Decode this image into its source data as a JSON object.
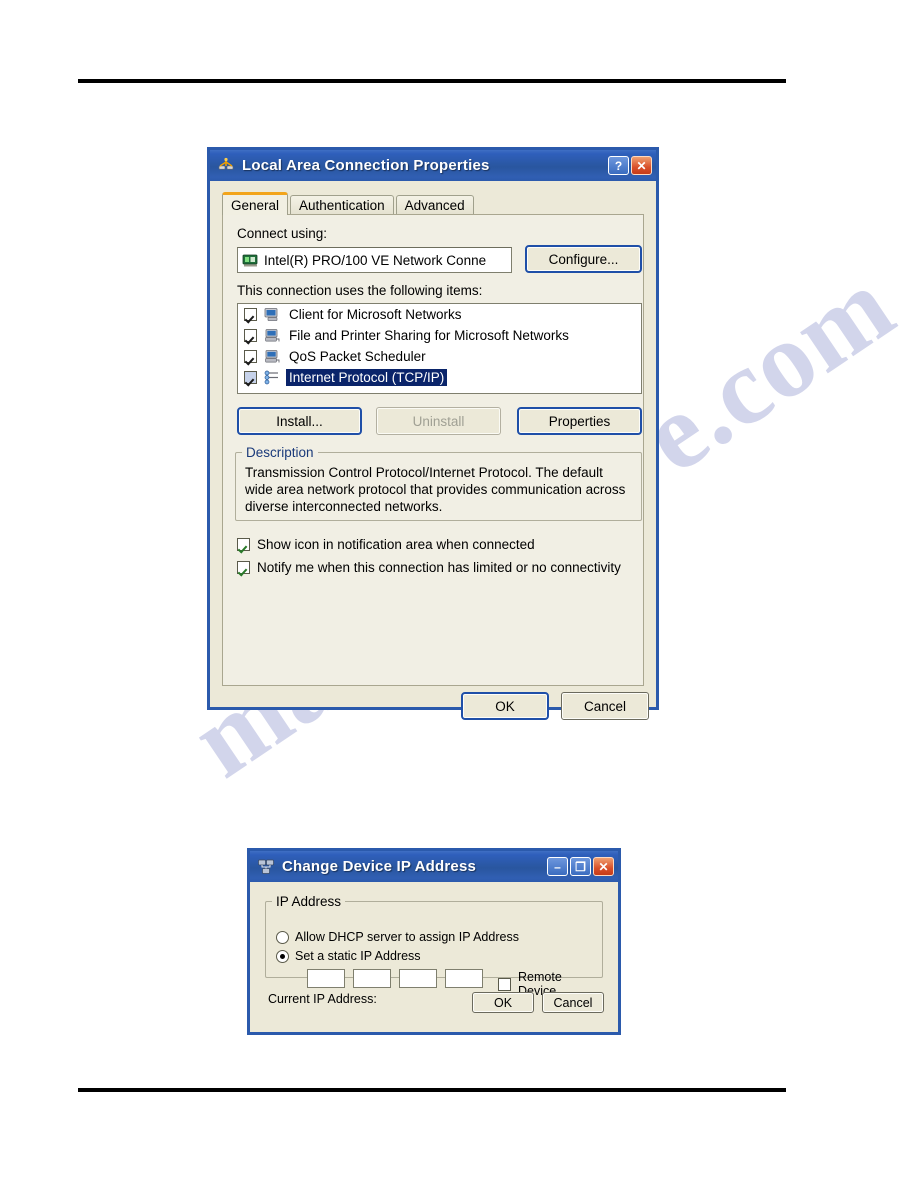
{
  "page": {
    "watermark": "manualshive.com"
  },
  "lan_dialog": {
    "title": "Local Area Connection Properties",
    "icon": "network-connection-icon",
    "titlebar_buttons": [
      {
        "name": "help-button",
        "glyph": "?"
      },
      {
        "name": "close-button",
        "glyph": "✕"
      }
    ],
    "tabs": [
      {
        "label": "General",
        "selected": true
      },
      {
        "label": "Authentication",
        "selected": false
      },
      {
        "label": "Advanced",
        "selected": false
      }
    ],
    "connect_using_label": "Connect using:",
    "adapter": {
      "name": "Intel(R) PRO/100 VE Network Conne",
      "icon": "network-adapter-icon"
    },
    "configure_button": "Configure...",
    "items_label": "This connection uses the following items:",
    "items": [
      {
        "label": "Client for Microsoft Networks",
        "checked": true,
        "selected": false,
        "icon": "client-computer-icon"
      },
      {
        "label": "File and Printer Sharing for Microsoft Networks",
        "checked": true,
        "selected": false,
        "icon": "file-sharing-icon"
      },
      {
        "label": "QoS Packet Scheduler",
        "checked": true,
        "selected": false,
        "icon": "qos-scheduler-icon"
      },
      {
        "label": "Internet Protocol (TCP/IP)",
        "checked": true,
        "selected": true,
        "icon": "protocol-icon"
      }
    ],
    "buttons": {
      "install": "Install...",
      "uninstall": "Uninstall",
      "properties": "Properties"
    },
    "description_legend": "Description",
    "description_text": "Transmission Control Protocol/Internet Protocol. The default wide area network protocol that provides communication across diverse interconnected networks.",
    "checkboxes": [
      {
        "label": "Show icon in notification area when connected",
        "checked": true
      },
      {
        "label": "Notify me when this connection has limited or no connectivity",
        "checked": true
      }
    ],
    "footer_buttons": {
      "ok": "OK",
      "cancel": "Cancel"
    }
  },
  "ip_dialog": {
    "title": "Change Device IP Address",
    "icon": "device-network-icon",
    "titlebar_buttons": [
      {
        "name": "minimize-button",
        "glyph": "–"
      },
      {
        "name": "maximize-button",
        "glyph": "❐"
      },
      {
        "name": "close-button",
        "glyph": "✕"
      }
    ],
    "group_legend": "IP Address",
    "radios": [
      {
        "label": "Allow DHCP server to assign IP Address",
        "selected": false
      },
      {
        "label": "Set a static IP Address",
        "selected": true
      }
    ],
    "octets": [
      "",
      "",
      "",
      ""
    ],
    "remote_device": {
      "label": "Remote Device",
      "checked": false
    },
    "current_ip_label": "Current IP Address:",
    "current_ip_value": "",
    "footer_buttons": {
      "ok": "OK",
      "cancel": "Cancel"
    }
  }
}
